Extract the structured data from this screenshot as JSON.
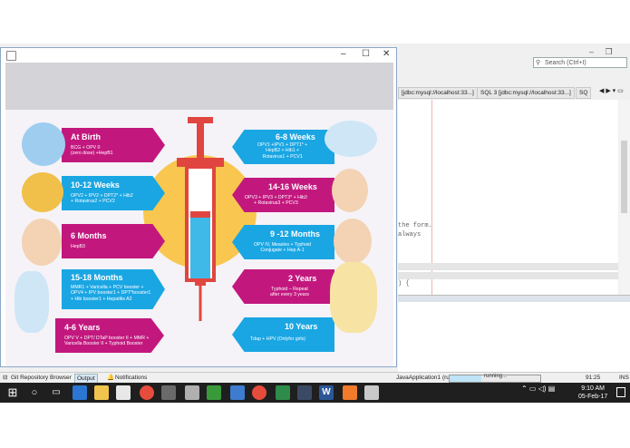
{
  "ide": {
    "search_placeholder": "Search (Ctrl+I)",
    "window_controls": [
      "–",
      "❐",
      "✕"
    ],
    "editor_tabs": [
      "[jdbc:mysql://localhost:33...]",
      "SQL 3 [jdbc:mysql://localhost:33...]",
      "SQ"
    ],
    "code_fragments": [
      "the form.",
      "always",
      ") {"
    ],
    "bottom_tabs": [
      "Git Repository Browser",
      "Output",
      "Notifications"
    ],
    "run_label": "JavaApplication1 (run)",
    "run_status": "running...",
    "cursor_pos": "91:25",
    "insert_mode": "INS"
  },
  "taskbar": {
    "time": "9:10 AM",
    "date": "05-Feb-17",
    "icons": [
      "windows-icon",
      "search-icon",
      "task-view-icon",
      "edge-icon",
      "explorer-icon",
      "store-icon",
      "chrome-icon",
      "app-icon",
      "app-icon",
      "app-icon",
      "app-icon",
      "chrome-icon",
      "app-icon",
      "app-icon",
      "word-icon",
      "app-icon",
      "app-icon"
    ]
  },
  "window": {
    "controls": [
      "–",
      "☐",
      "✕"
    ]
  },
  "poster": {
    "left": [
      {
        "title": "At Birth",
        "desc": "BCG + OPV 0\n(zero dose) +HepB1",
        "color": "magenta"
      },
      {
        "title": "10-12 Weeks",
        "desc": "OPV2 + IPV2 + DPT2* + Hib2\n+ Rotavirus2 + PCV2",
        "color": "cyan"
      },
      {
        "title": "6 Months",
        "desc": "HepB3",
        "color": "magenta"
      },
      {
        "title": "15-18 Months",
        "desc": "MMR1 + Varicella + PCV booster +\nOPV4 + IPV booster1 + DPT*booster1\n+ Hib booster1 + Hepatitis A2",
        "color": "cyan"
      },
      {
        "title": "4-6 Years",
        "desc": "OPV V + DPT/ DTaP booster II + MMR +\nVaricella Booster II + Typhoid Booster",
        "color": "magenta"
      }
    ],
    "right": [
      {
        "title": "6-8 Weeks",
        "desc": "OPV1 +IPV1 + DPT1* +\nHepB2 + Hib1 +\nRotavirus1 + PCV1",
        "color": "cyan"
      },
      {
        "title": "14-16 Weeks",
        "desc": "OPV3 + IPV3 + DPT3* + Hib3\n+ Rotavirus3 + PCV3",
        "color": "magenta"
      },
      {
        "title": "9 -12 Months",
        "desc": "OPV IV, Measles + Typhoid\nConjugate + Hep A-1",
        "color": "cyan"
      },
      {
        "title": "2 Years",
        "desc": "Typhoid – Repeat\nafter every 3 years",
        "color": "magenta"
      },
      {
        "title": "10 Years",
        "desc": "Tdap + HPV (Onlyfor girls)",
        "color": "cyan"
      }
    ],
    "colors": {
      "magenta": "#c2187e",
      "cyan": "#1aa6e3",
      "syringe_red": "#e0463f",
      "liquid": "#3fb9e8",
      "sun": "#f9c74f"
    }
  }
}
